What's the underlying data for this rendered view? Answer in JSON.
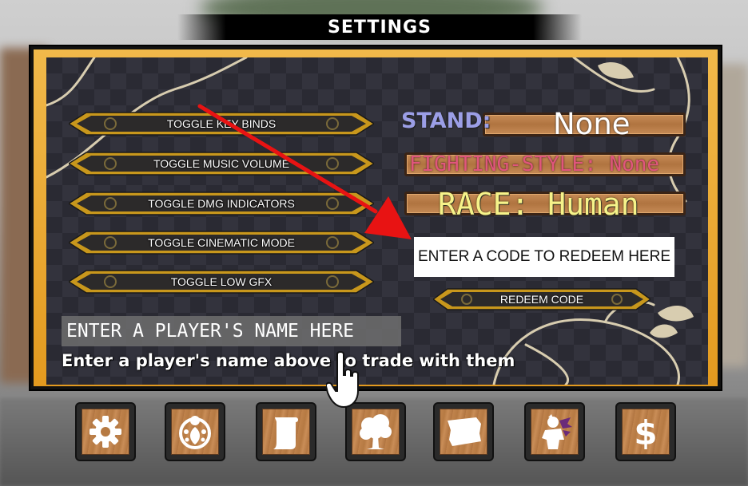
{
  "title": "SETTINGS",
  "toggles": [
    {
      "label": "TOGGLE KEY BINDS"
    },
    {
      "label": "TOGGLE MUSIC VOLUME"
    },
    {
      "label": "TOGGLE DMG INDICATORS"
    },
    {
      "label": "TOGGLE CINEMATIC MODE"
    },
    {
      "label": "TOGGLE LOW GFX"
    }
  ],
  "stats": {
    "stand_label": "STAND:",
    "stand_value": "None",
    "fighting_style": "FIGHTING-STYLE: None",
    "race": "RACE: Human"
  },
  "code": {
    "placeholder": "ENTER A CODE TO REDEEM HERE",
    "redeem_label": "REDEEM CODE"
  },
  "trade": {
    "placeholder": "ENTER A PLAYER'S NAME HERE",
    "hint": "Enter a player's name above to trade with them"
  },
  "bottom_icons": [
    "gear-icon",
    "ladybug-icon",
    "scroll-icon",
    "tree-icon",
    "banner-icon",
    "character-icon",
    "dollar-icon"
  ],
  "colors": {
    "panel_gold": "#e39a1f",
    "stand_label": "#9b9ee6",
    "fighting_style": "#e0567c",
    "race": "#f6f38a",
    "arrow": "#e81313"
  }
}
